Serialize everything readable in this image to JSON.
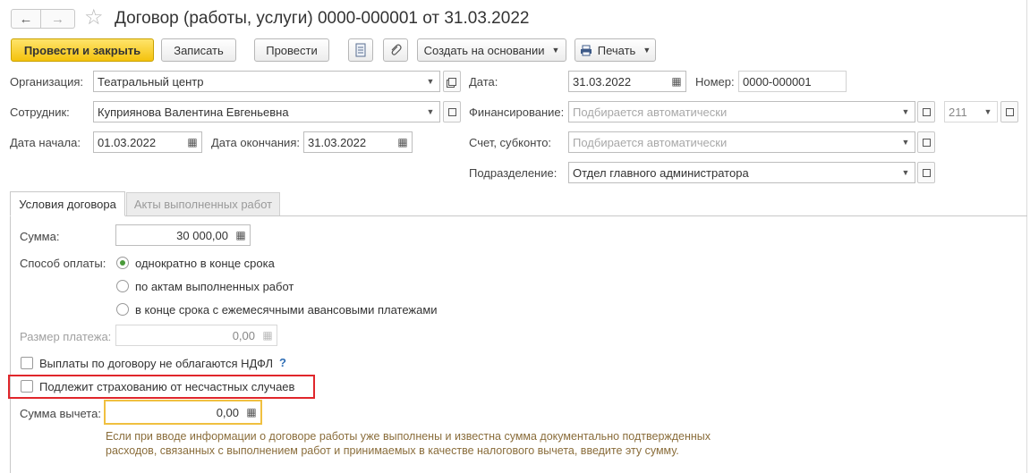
{
  "title": "Договор (работы, услуги) 0000-000001 от 31.03.2022",
  "nav": {
    "back": "←",
    "forward": "→",
    "favorite": "☆"
  },
  "toolbar": {
    "post_close": "Провести и закрыть",
    "save": "Записать",
    "post": "Провести",
    "create_based": "Создать на основании",
    "print": "Печать"
  },
  "header": {
    "org_label": "Организация:",
    "org_value": "Театральный центр",
    "date_label": "Дата:",
    "date_value": "31.03.2022",
    "number_label": "Номер:",
    "number_value": "0000-000001",
    "employee_label": "Сотрудник:",
    "employee_value": "Куприянова Валентина Евгеньевна",
    "financing_label": "Финансирование:",
    "financing_placeholder": "Подбирается автоматически",
    "kfo_value": "211",
    "start_label": "Дата начала:",
    "start_value": "01.03.2022",
    "end_label": "Дата окончания:",
    "end_value": "31.03.2022",
    "account_label": "Счет, субконто:",
    "account_placeholder": "Подбирается автоматически",
    "dept_label": "Подразделение:",
    "dept_value": "Отдел главного администратора"
  },
  "tabs": [
    {
      "label": "Условия договора",
      "active": true
    },
    {
      "label": "Акты выполненных работ",
      "active": false
    }
  ],
  "terms": {
    "sum_label": "Сумма:",
    "sum_value": "30 000,00",
    "payment_label": "Способ оплаты:",
    "payment_options": [
      {
        "label": "однократно в конце срока",
        "selected": true
      },
      {
        "label": "по актам выполненных работ",
        "selected": false
      },
      {
        "label": "в конце срока с ежемесячными авансовыми платежами",
        "selected": false
      }
    ],
    "installment_label": "Размер платежа:",
    "installment_value": "0,00",
    "ndfl_checkbox": "Выплаты по договору не облагаются НДФЛ",
    "ndfl_help": "?",
    "insurance_checkbox": "Подлежит страхованию от несчастных случаев",
    "deduction_label": "Сумма вычета:",
    "deduction_value": "0,00",
    "hint_line1": "Если при вводе информации о договоре работы уже выполнены и известна сумма документально подтвержденных",
    "hint_line2": "расходов, связанных с выполнением работ и принимаемых в качестве налогового вычета, введите эту сумму."
  },
  "colors": {
    "primary_button": "#f4c20d",
    "highlight_border": "#e0262b",
    "focus_border": "#f0c040",
    "hint_text": "#8a6d3b"
  }
}
